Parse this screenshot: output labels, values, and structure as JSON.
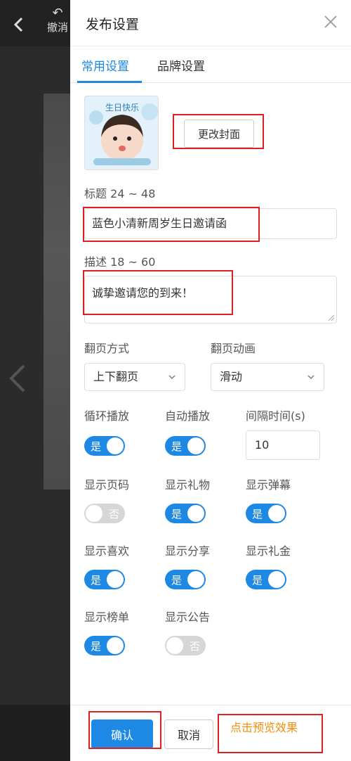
{
  "background": {
    "undo_label": "撤消"
  },
  "panel": {
    "title": "发布设置",
    "tabs": [
      {
        "label": "常用设置",
        "active": true
      },
      {
        "label": "品牌设置",
        "active": false
      }
    ]
  },
  "cover": {
    "banner_text": "生日快乐",
    "change_button": "更改封面"
  },
  "title_field": {
    "label": "标题 24 ~ 48",
    "value": "蓝色小清新周岁生日邀请函"
  },
  "desc_field": {
    "label": "描述 18 ~ 60",
    "value": "诚挚邀请您的到来！"
  },
  "page_turn": {
    "mode_label": "翻页方式",
    "mode_value": "上下翻页",
    "anim_label": "翻页动画",
    "anim_value": "滑动"
  },
  "interval": {
    "label": "间隔时间(s)",
    "value": "10"
  },
  "toggles": [
    {
      "label": "循环播放",
      "state": "on",
      "text": "是"
    },
    {
      "label": "自动播放",
      "state": "on",
      "text": "是"
    },
    {
      "label": "显示页码",
      "state": "off",
      "text": "否"
    },
    {
      "label": "显示礼物",
      "state": "on",
      "text": "是"
    },
    {
      "label": "显示弹幕",
      "state": "on",
      "text": "是"
    },
    {
      "label": "显示喜欢",
      "state": "on",
      "text": "是"
    },
    {
      "label": "显示分享",
      "state": "on",
      "text": "是"
    },
    {
      "label": "显示礼金",
      "state": "on",
      "text": "是"
    },
    {
      "label": "显示榜单",
      "state": "on",
      "text": "是"
    },
    {
      "label": "显示公告",
      "state": "off",
      "text": "否"
    }
  ],
  "footer": {
    "confirm": "确认",
    "cancel": "取消",
    "preview": "点击预览效果"
  },
  "colors": {
    "accent": "#1e88e5",
    "highlight": "#e02020",
    "preview": "#f58c08"
  }
}
